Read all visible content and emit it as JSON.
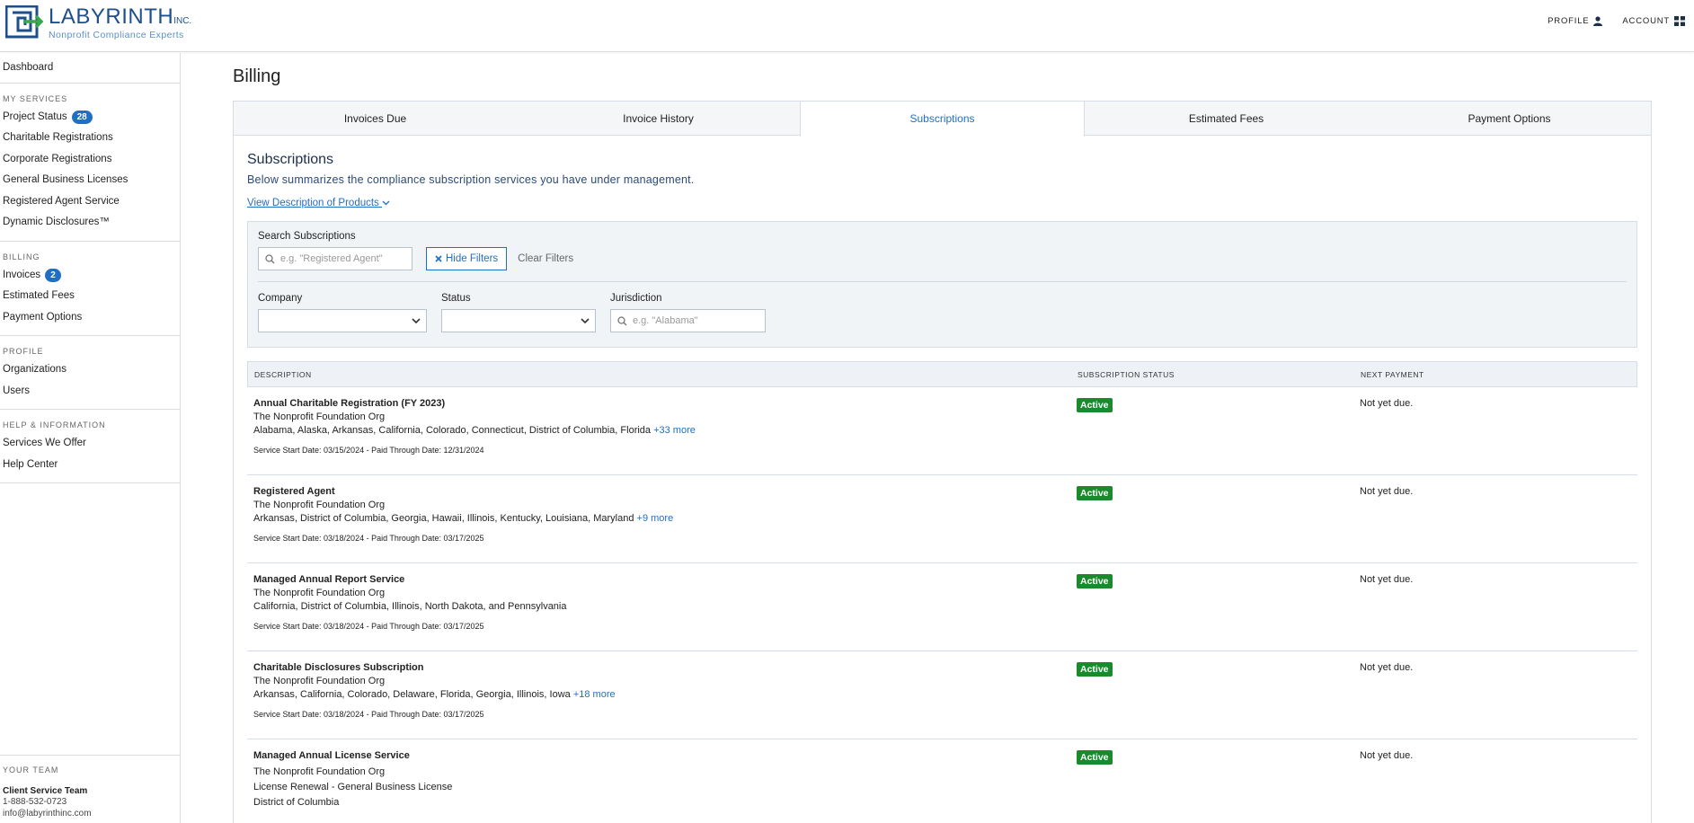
{
  "header": {
    "brand": "LABYRINTH",
    "brand_suffix": "INC.",
    "tagline": "Nonprofit Compliance Experts",
    "profile_label": "PROFILE",
    "account_label": "ACCOUNT"
  },
  "sidebar": {
    "dashboard": "Dashboard",
    "my_services_heading": "MY SERVICES",
    "project_status": "Project Status",
    "project_status_count": "28",
    "charitable_registrations": "Charitable Registrations",
    "corporate_registrations": "Corporate Registrations",
    "general_business_licenses": "General Business Licenses",
    "registered_agent_service": "Registered Agent Service",
    "dynamic_disclosures": "Dynamic Disclosures™",
    "billing_heading": "BILLING",
    "invoices": "Invoices",
    "invoices_count": "2",
    "estimated_fees": "Estimated Fees",
    "payment_options": "Payment Options",
    "profile_heading": "PROFILE",
    "organizations": "Organizations",
    "users": "Users",
    "help_heading": "HELP & INFORMATION",
    "services_we_offer": "Services We Offer",
    "help_center": "Help Center",
    "team_heading": "YOUR TEAM",
    "team_name": "Client Service Team",
    "team_phone": "1-888-532-0723",
    "team_email": "info@labyrinthinc.com"
  },
  "page": {
    "title": "Billing",
    "tabs": [
      "Invoices Due",
      "Invoice History",
      "Subscriptions",
      "Estimated Fees",
      "Payment Options"
    ],
    "active_tab": "Subscriptions",
    "section_title": "Subscriptions",
    "section_desc": "Below summarizes the compliance subscription services you have under management.",
    "view_link": "View Description of Products"
  },
  "filters": {
    "search_label": "Search Subscriptions",
    "search_placeholder": "e.g. \"Registered Agent\"",
    "hide_filters": "Hide Filters",
    "clear_filters": "Clear Filters",
    "company_label": "Company",
    "status_label": "Status",
    "jurisdiction_label": "Jurisdiction",
    "jurisdiction_placeholder": "e.g. \"Alabama\""
  },
  "table": {
    "col_description": "DESCRIPTION",
    "col_status": "SUBSCRIPTION STATUS",
    "col_next": "NEXT PAYMENT",
    "rows": [
      {
        "title": "Annual Charitable Registration (FY 2023)",
        "org": "The Nonprofit Foundation Org",
        "states": "Alabama, Alaska, Arkansas, California, Colorado, Connecticut, District of Columbia, Florida",
        "more": "+33 more",
        "dates": "Service Start Date: 03/15/2024 - Paid Through Date: 12/31/2024",
        "status": "Active",
        "next": "Not yet due."
      },
      {
        "title": "Registered Agent",
        "org": "The Nonprofit Foundation Org",
        "states": "Arkansas, District of Columbia, Georgia, Hawaii, Illinois, Kentucky, Louisiana, Maryland",
        "more": "+9 more",
        "dates": "Service Start Date: 03/18/2024 - Paid Through Date: 03/17/2025",
        "status": "Active",
        "next": "Not yet due."
      },
      {
        "title": "Managed Annual Report Service",
        "org": "The Nonprofit Foundation Org",
        "states": "California, District of Columbia, Illinois, North Dakota, and Pennsylvania",
        "more": "",
        "dates": "Service Start Date: 03/18/2024 - Paid Through Date: 03/17/2025",
        "status": "Active",
        "next": "Not yet due."
      },
      {
        "title": "Charitable Disclosures Subscription",
        "org": "The Nonprofit Foundation Org",
        "states": "Arkansas, California, Colorado, Delaware, Florida, Georgia, Illinois, Iowa",
        "more": "+18 more",
        "dates": "Service Start Date: 03/18/2024 - Paid Through Date: 03/17/2025",
        "status": "Active",
        "next": "Not yet due."
      },
      {
        "title": "Managed Annual License Service",
        "org": "The Nonprofit Foundation Org",
        "states": "License Renewal - General Business License",
        "more": "",
        "extra": "District of Columbia",
        "dates": "",
        "status": "Active",
        "next": "Not yet due."
      }
    ]
  },
  "colors": {
    "brand_blue": "#1e4f8a",
    "link_blue": "#1f6fc4",
    "active_green": "#1a8a2c",
    "logo_green": "#3aa84a"
  }
}
